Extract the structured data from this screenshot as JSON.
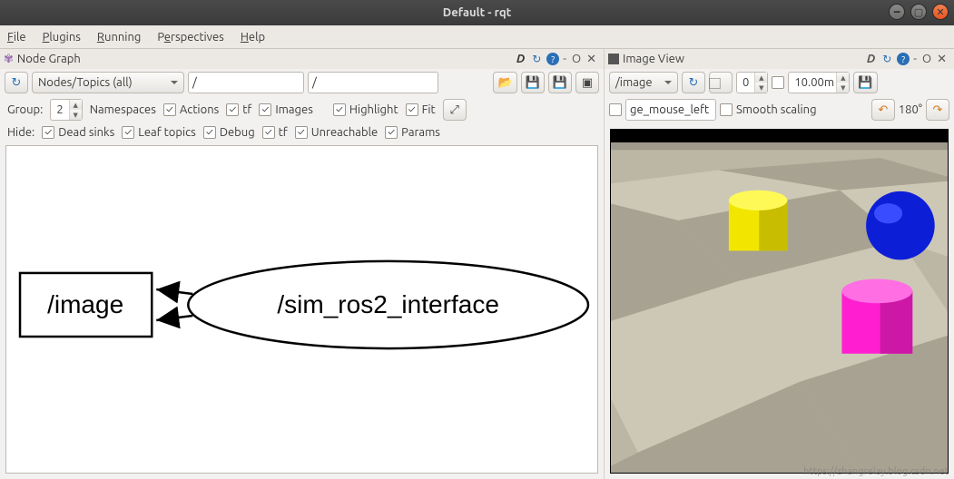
{
  "window": {
    "title": "Default - rqt"
  },
  "menubar": {
    "file": "File",
    "plugins": "Plugins",
    "running": "Running",
    "perspectives": "Perspectives",
    "help": "Help"
  },
  "nodegraph": {
    "title": "Node Graph",
    "header_icons": {
      "d": "D",
      "dash": "-",
      "o": "O",
      "x": "✕"
    },
    "combo_mode": "Nodes/Topics (all)",
    "filter1": "/",
    "filter2": "/",
    "group_label": "Group:",
    "group_value": "2",
    "namespaces_label": "Namespaces",
    "cb_actions": "Actions",
    "cb_tf": "tf",
    "cb_images": "Images",
    "cb_highlight": "Highlight",
    "cb_fit": "Fit",
    "hide_label": "Hide:",
    "cb_deadsinks": "Dead sinks",
    "cb_leaftopics": "Leaf topics",
    "cb_debug": "Debug",
    "cb_tf2": "tf",
    "cb_unreachable": "Unreachable",
    "cb_params": "Params",
    "graph": {
      "node_topic": "/image",
      "node_name": "/sim_ros2_interface"
    }
  },
  "imageview": {
    "title": "Image View",
    "header_icons": {
      "d": "D",
      "dash": "-",
      "o": "O",
      "x": "✕"
    },
    "topic": "/image",
    "num_val": "0",
    "zoom_val": "10.00m",
    "option_text": "ge_mouse_left",
    "smooth_label": "Smooth scaling",
    "rotate_label": "180°"
  },
  "watermark": "https://zhangrelay.blog.csdn.net"
}
